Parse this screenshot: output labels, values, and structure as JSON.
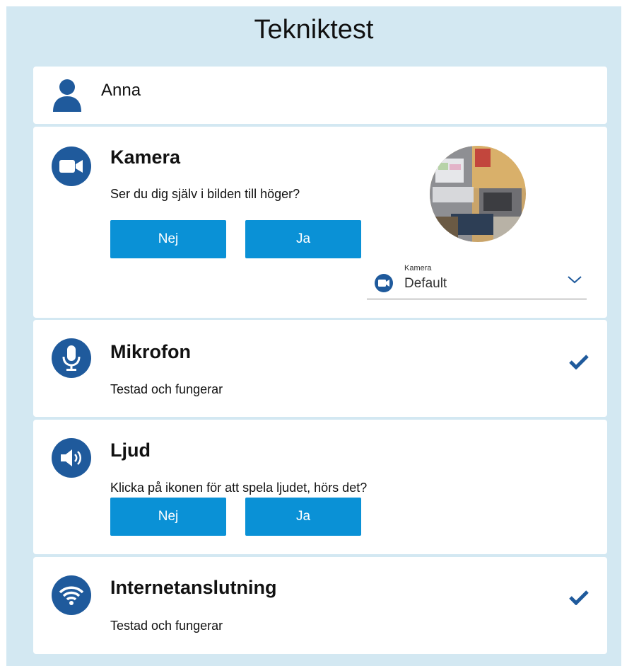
{
  "page": {
    "title": "Tekniktest"
  },
  "user": {
    "name": "Anna",
    "icon": "user-icon"
  },
  "camera": {
    "title": "Kamera",
    "question": "Ser du dig själv i bilden till höger?",
    "no_label": "Nej",
    "yes_label": "Ja",
    "icon": "video-camera-icon",
    "select": {
      "label": "Kamera",
      "value": "Default"
    }
  },
  "microphone": {
    "title": "Mikrofon",
    "status": "Testad och fungerar",
    "icon": "microphone-icon",
    "tested": true
  },
  "sound": {
    "title": "Ljud",
    "question": "Klicka på ikonen för att spela ljudet, hörs det?",
    "no_label": "Nej",
    "yes_label": "Ja",
    "icon": "speaker-icon"
  },
  "internet": {
    "title": "Internetanslutning",
    "status": "Testad och fungerar",
    "icon": "wifi-icon",
    "tested": true
  },
  "colors": {
    "background": "#d3e8f2",
    "icon_blue": "#1f5a9c",
    "button_blue": "#0a91d6"
  }
}
